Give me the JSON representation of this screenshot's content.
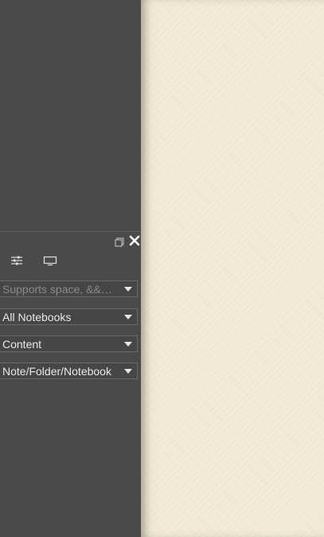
{
  "search_panel": {
    "query": {
      "placeholder": "Supports space, &&…"
    },
    "scope_select": {
      "selected": "All Notebooks"
    },
    "field_select": {
      "selected": "Content"
    },
    "target_select": {
      "selected": "Note/Folder/Notebook"
    },
    "icons": {
      "restore": "restore-window-icon",
      "close": "close-icon",
      "settings": "sliders-icon",
      "display": "monitor-icon",
      "dropdown": "triangle-down-icon"
    }
  },
  "colors": {
    "panel_bg": "#4a4a4a",
    "paper_bg": "#f2e9d6",
    "text": "#e8e8e8",
    "placeholder": "#8a8a8a"
  }
}
